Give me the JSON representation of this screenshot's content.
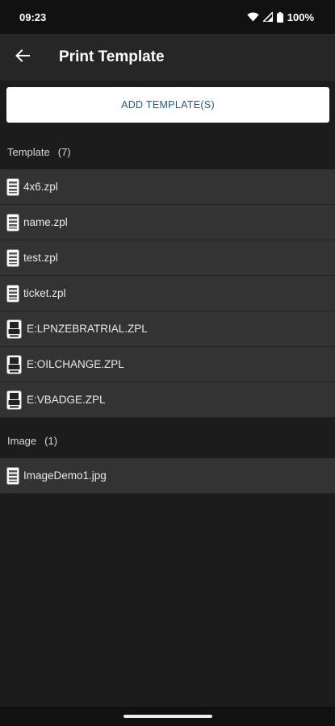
{
  "status_bar": {
    "time": "09:23",
    "battery": "100%",
    "icons": [
      "wifi-icon",
      "signal-icon",
      "battery-icon"
    ]
  },
  "app_bar": {
    "title": "Print Template",
    "back_icon": "arrow-left-icon"
  },
  "add_button": {
    "label": "ADD TEMPLATE(S)",
    "color": "#1a5b93"
  },
  "sections": {
    "template": {
      "label": "Template",
      "count": "(7)",
      "items": [
        {
          "name": "4x6.zpl",
          "icon": "file-document-icon"
        },
        {
          "name": "name.zpl",
          "icon": "file-document-icon"
        },
        {
          "name": "test.zpl",
          "icon": "file-document-icon"
        },
        {
          "name": "ticket.zpl",
          "icon": "file-document-icon"
        },
        {
          "name": "E:LPNZEBRATRIAL.ZPL",
          "icon": "printer-file-icon"
        },
        {
          "name": "E:OILCHANGE.ZPL",
          "icon": "printer-file-icon"
        },
        {
          "name": "E:VBADGE.ZPL",
          "icon": "printer-file-icon"
        }
      ]
    },
    "image": {
      "label": "Image",
      "count": "(1)",
      "items": [
        {
          "name": "ImageDemo1.jpg",
          "icon": "file-document-icon"
        }
      ]
    }
  },
  "colors": {
    "background": "#1c1c1c",
    "app_bar": "#262626",
    "row": "#333333",
    "status_bar": "#111111"
  }
}
